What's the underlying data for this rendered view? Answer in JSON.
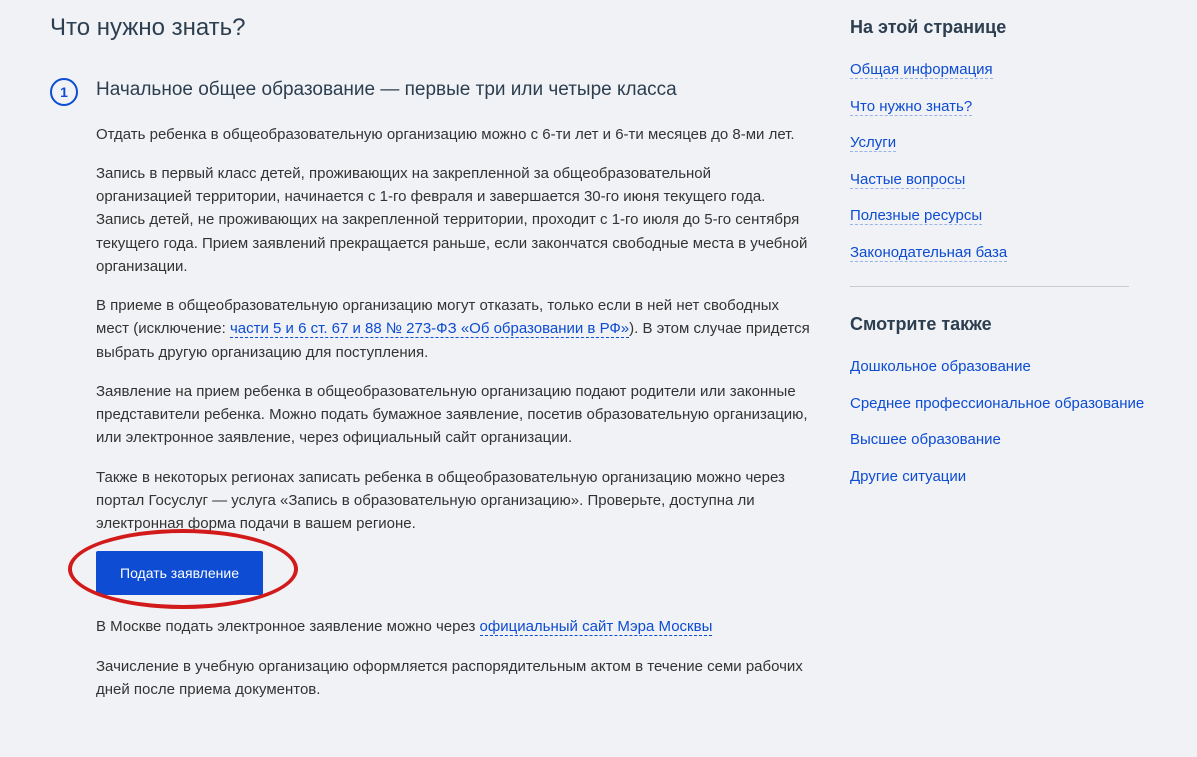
{
  "main": {
    "title": "Что нужно знать?",
    "item": {
      "number": "1",
      "heading": "Начальное общее образование — первые три или четыре класса",
      "p1": "Отдать ребенка в общеобразовательную организацию можно с 6-ти лет и 6-ти месяцев до 8-ми лет.",
      "p2": "Запись в первый класс детей, проживающих на закрепленной за общеобразовательной организацией территории, начинается с 1-го февраля и завершается 30-го июня текущего года. Запись детей, не проживающих на закрепленной территории, проходит с 1-го июля до 5-го сентября текущего года. Прием заявлений прекращается раньше, если закончатся свободные места в учебной организации.",
      "p3_pre": "В приеме в общеобразовательную организацию могут отказать, только если в ней нет свободных мест (исключение: ",
      "p3_link": "части 5 и 6 ст. 67 и 88 № 273-ФЗ «Об образовании в РФ»",
      "p3_post": "). В этом случае придется выбрать другую организацию для поступления.",
      "p4": "Заявление на прием ребенка в общеобразовательную организацию подают родители или законные представители ребенка. Можно подать бумажное заявление, посетив образовательную организацию, или электронное заявление, через официальный сайт организации.",
      "p5": "Также в некоторых регионах записать ребенка в общеобразовательную организацию можно через портал Госуслуг — услуга «Запись в образовательную организацию». Проверьте, доступна ли электронная форма подачи в вашем регионе.",
      "button": "Подать заявление",
      "p6_pre": "В Москве подать электронное заявление можно через ",
      "p6_link": "официальный сайт Мэра Москвы",
      "p7": "Зачисление в учебную организацию оформляется распорядительным актом в течение семи рабочих дней после приема документов."
    }
  },
  "sidebar": {
    "onpage_title": "На этой странице",
    "onpage_links": [
      "Общая информация",
      "Что нужно знать?",
      "Услуги",
      "Частые вопросы",
      "Полезные ресурсы",
      "Законодательная база"
    ],
    "seealso_title": "Смотрите также",
    "seealso_links": [
      "Дошкольное образование",
      "Среднее профессиональное образование",
      "Высшее образование",
      "Другие ситуации"
    ]
  }
}
